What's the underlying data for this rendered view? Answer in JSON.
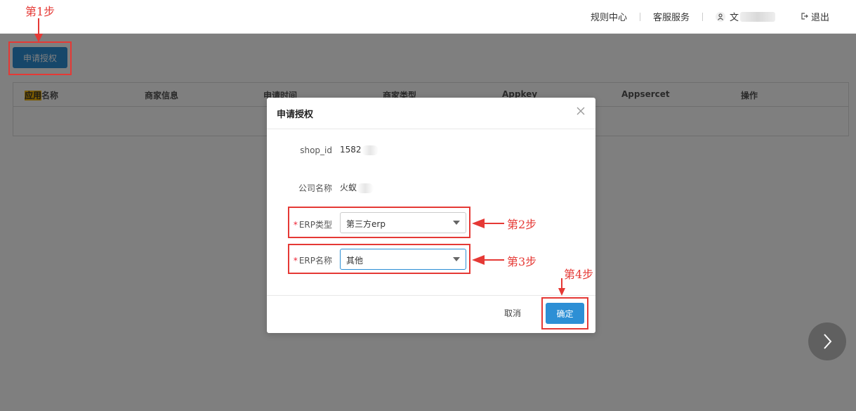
{
  "topnav": {
    "rules": "规则中心",
    "service": "客服服务",
    "username": "文",
    "logout": "退出"
  },
  "page": {
    "apply_button": "申请授权",
    "table": {
      "headers": [
        {
          "highlight": "应用",
          "rest": "名称"
        },
        {
          "highlight": "",
          "rest": "商家信息"
        },
        {
          "highlight": "",
          "rest": "申请时间"
        },
        {
          "highlight": "",
          "rest": "商家类型"
        },
        {
          "highlight": "",
          "rest": "Appkey"
        },
        {
          "highlight": "",
          "rest": "Appsercet"
        },
        {
          "highlight": "",
          "rest": "操作"
        }
      ]
    }
  },
  "modal": {
    "title": "申请授权",
    "fields": {
      "shop_id_label": "shop_id",
      "shop_id_value": "1582",
      "company_label": "公司名称",
      "company_value": "火蚁",
      "erp_type_label": "ERP类型",
      "erp_type_value": "第三方erp",
      "erp_name_label": "ERP名称",
      "erp_name_value": "其他",
      "required_mark": "*"
    },
    "cancel": "取消",
    "confirm": "确定"
  },
  "annotations": {
    "step1": "第1步",
    "step2": "第2步",
    "step3": "第3步",
    "step4": "第4步",
    "color": "#e53935"
  },
  "colors": {
    "primary": "#2d8fd5",
    "highlight": "#f5b400"
  }
}
